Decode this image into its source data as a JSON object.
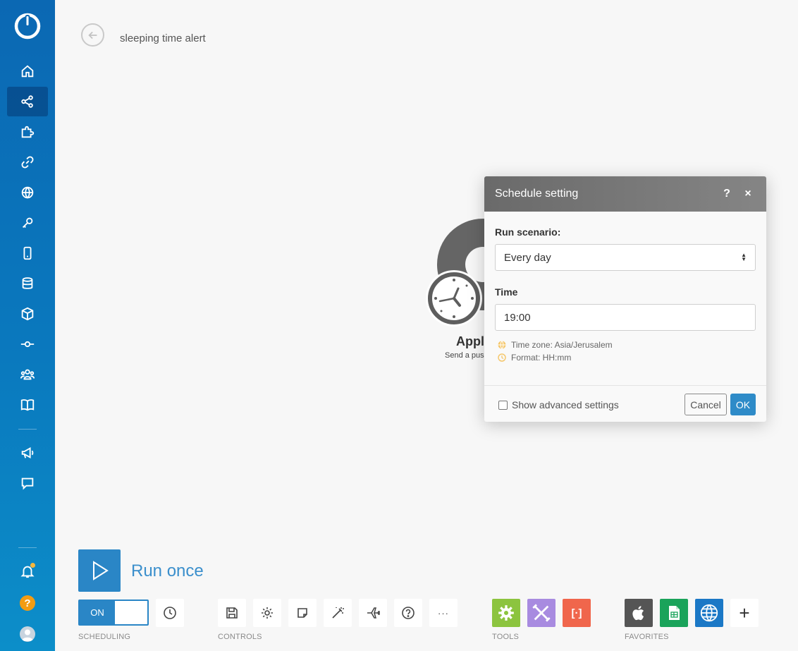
{
  "header": {
    "scenario_title": "sleeping time alert"
  },
  "sidebar": {
    "items": [
      {
        "name": "home-icon"
      },
      {
        "name": "share-icon",
        "active": true
      },
      {
        "name": "puzzle-icon"
      },
      {
        "name": "link-icon"
      },
      {
        "name": "globe-icon"
      },
      {
        "name": "key-icon"
      },
      {
        "name": "phone-icon"
      },
      {
        "name": "database-icon"
      },
      {
        "name": "cube-icon"
      },
      {
        "name": "flow-icon"
      },
      {
        "name": "team-icon"
      },
      {
        "name": "book-icon"
      },
      {
        "name": "megaphone-icon"
      },
      {
        "name": "chat-icon"
      }
    ],
    "bottom": {
      "help_label": "?"
    }
  },
  "module": {
    "label": "Appl",
    "sub": "Send a push"
  },
  "dialog": {
    "title": "Schedule setting",
    "help": "?",
    "close": "×",
    "run_label": "Run scenario:",
    "run_value": "Every day",
    "time_label": "Time",
    "time_value": "19:00",
    "timezone_hint": "Time zone: Asia/Jerusalem",
    "format_hint": "Format: HH:mm",
    "advanced_label": "Show advanced settings",
    "cancel": "Cancel",
    "ok": "OK"
  },
  "toolbar": {
    "run_once": "Run once",
    "toggle_on": "ON",
    "scheduling_label": "SCHEDULING",
    "controls_label": "CONTROLS",
    "tools_label": "TOOLS",
    "favorites_label": "FAVORITES",
    "more": "···",
    "add": "+",
    "text_parser_glyph": "[·]"
  },
  "colors": {
    "accent": "#2a86c6",
    "tools_green": "#8cc43f",
    "tools_purple": "#a88be0",
    "tools_red": "#f0664c",
    "fav_apple": "#555555",
    "fav_sheets": "#1aa35a",
    "fav_http": "#1b78c6"
  }
}
